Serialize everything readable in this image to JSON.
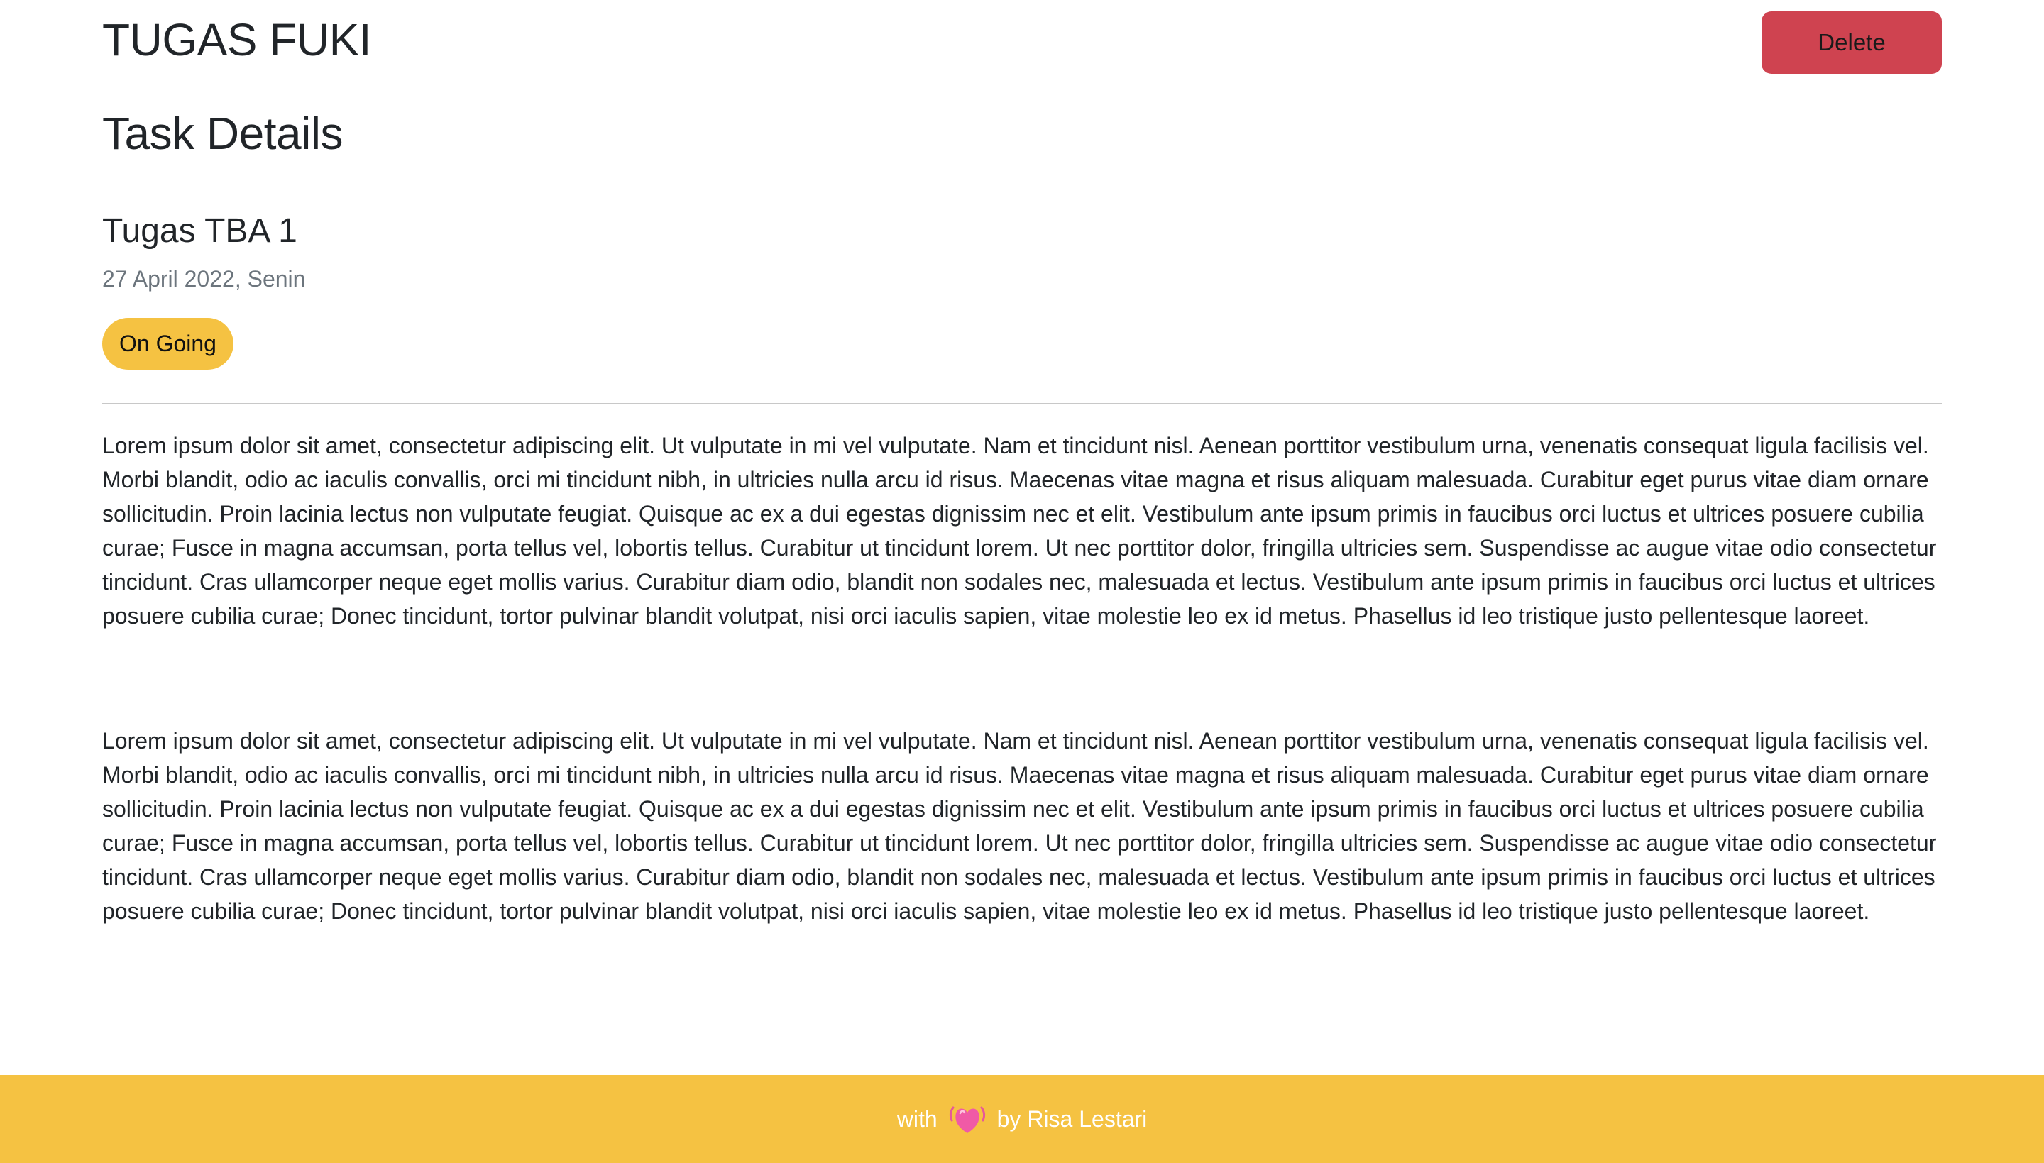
{
  "header": {
    "brand": "TUGAS FUKI",
    "delete_label": "Delete"
  },
  "main": {
    "page_title": "Task Details",
    "task": {
      "title": "Tugas TBA 1",
      "date": "27 April 2022, Senin",
      "status": "On Going",
      "paragraphs": [
        "Lorem ipsum dolor sit amet, consectetur adipiscing elit. Ut vulputate in mi vel vulputate. Nam et tincidunt nisl. Aenean porttitor vestibulum urna, venenatis consequat ligula facilisis vel. Morbi blandit, odio ac iaculis convallis, orci mi tincidunt nibh, in ultricies nulla arcu id risus. Maecenas vitae magna et risus aliquam malesuada. Curabitur eget purus vitae diam ornare sollicitudin. Proin lacinia lectus non vulputate feugiat. Quisque ac ex a dui egestas dignissim nec et elit. Vestibulum ante ipsum primis in faucibus orci luctus et ultrices posuere cubilia curae; Fusce in magna accumsan, porta tellus vel, lobortis tellus. Curabitur ut tincidunt lorem. Ut nec porttitor dolor, fringilla ultricies sem. Suspendisse ac augue vitae odio consectetur tincidunt. Cras ullamcorper neque eget mollis varius. Curabitur diam odio, blandit non sodales nec, malesuada et lectus. Vestibulum ante ipsum primis in faucibus orci luctus et ultrices posuere cubilia curae; Donec tincidunt, tortor pulvinar blandit volutpat, nisi orci iaculis sapien, vitae molestie leo ex id metus. Phasellus id leo tristique justo pellentesque laoreet.",
        "Lorem ipsum dolor sit amet, consectetur adipiscing elit. Ut vulputate in mi vel vulputate. Nam et tincidunt nisl. Aenean porttitor vestibulum urna, venenatis consequat ligula facilisis vel. Morbi blandit, odio ac iaculis convallis, orci mi tincidunt nibh, in ultricies nulla arcu id risus. Maecenas vitae magna et risus aliquam malesuada. Curabitur eget purus vitae diam ornare sollicitudin. Proin lacinia lectus non vulputate feugiat. Quisque ac ex a dui egestas dignissim nec et elit. Vestibulum ante ipsum primis in faucibus orci luctus et ultrices posuere cubilia curae; Fusce in magna accumsan, porta tellus vel, lobortis tellus. Curabitur ut tincidunt lorem. Ut nec porttitor dolor, fringilla ultricies sem. Suspendisse ac augue vitae odio consectetur tincidunt. Cras ullamcorper neque eget mollis varius. Curabitur diam odio, blandit non sodales nec, malesuada et lectus. Vestibulum ante ipsum primis in faucibus orci luctus et ultrices posuere cubilia curae; Donec tincidunt, tortor pulvinar blandit volutpat, nisi orci iaculis sapien, vitae molestie leo ex id metus. Phasellus id leo tristique justo pellentesque laoreet."
      ]
    }
  },
  "footer": {
    "prefix": "with",
    "icon": "heart-icon",
    "suffix": "by Risa Lestari"
  },
  "colors": {
    "accent": "#f5c242",
    "danger": "#cf4350",
    "muted": "#6c757d",
    "text": "#212529"
  }
}
